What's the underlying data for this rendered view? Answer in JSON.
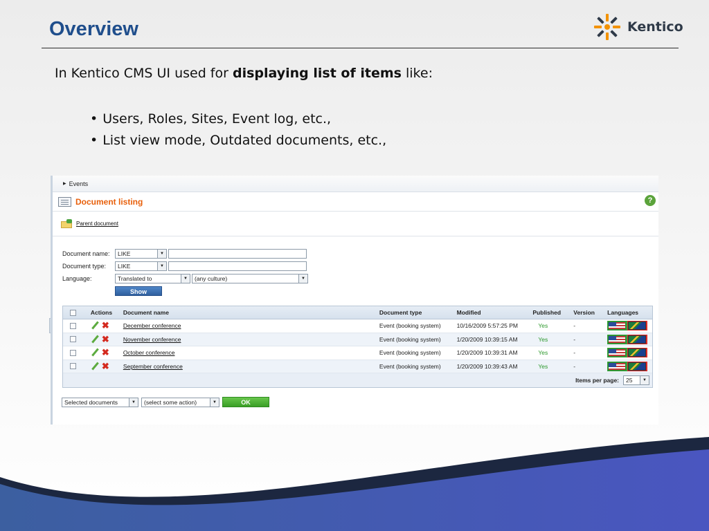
{
  "slide": {
    "title": "Overview",
    "logo_text": "Kentico",
    "intro_prefix": "In Kentico CMS UI used for ",
    "intro_bold": "displaying list of items",
    "intro_suffix": " like:",
    "bullets": [
      "Users, Roles, Sites, Event log, etc.,",
      "List view mode, Outdated documents, etc.,"
    ]
  },
  "app": {
    "breadcrumb": "Events",
    "page_title": "Document listing",
    "help_icon": "?",
    "parent_link": "Parent document",
    "filter": {
      "document_name_label": "Document name:",
      "document_name_op": "LIKE",
      "document_name_value": "",
      "document_type_label": "Document type:",
      "document_type_op": "LIKE",
      "document_type_value": "",
      "language_label": "Language:",
      "language_op": "Translated to",
      "language_value": "(any culture)",
      "show_button": "Show"
    },
    "grid": {
      "headers": {
        "actions": "Actions",
        "name": "Document name",
        "type": "Document type",
        "modified": "Modified",
        "published": "Published",
        "version": "Version",
        "languages": "Languages"
      },
      "rows": [
        {
          "name": "December conference",
          "type": "Event (booking system)",
          "modified": "10/16/2009 5:57:25 PM",
          "published": "Yes",
          "version": "-"
        },
        {
          "name": "November conference",
          "type": "Event (booking system)",
          "modified": "1/20/2009 10:39:15 AM",
          "published": "Yes",
          "version": "-"
        },
        {
          "name": "October conference",
          "type": "Event (booking system)",
          "modified": "1/20/2009 10:39:31 AM",
          "published": "Yes",
          "version": "-"
        },
        {
          "name": "September conference",
          "type": "Event (booking system)",
          "modified": "1/20/2009 10:39:43 AM",
          "published": "Yes",
          "version": "-"
        }
      ],
      "items_per_page_label": "Items per page:",
      "items_per_page_value": "25"
    },
    "mass_action": {
      "scope": "Selected documents",
      "action": "(select some action)",
      "ok_button": "OK"
    }
  },
  "colors": {
    "title": "#1f4e8c",
    "page_title": "#e8600c",
    "published": "#2e9a2e",
    "wave_dark": "#1c2740",
    "wave_blue": "#4a56c0"
  }
}
